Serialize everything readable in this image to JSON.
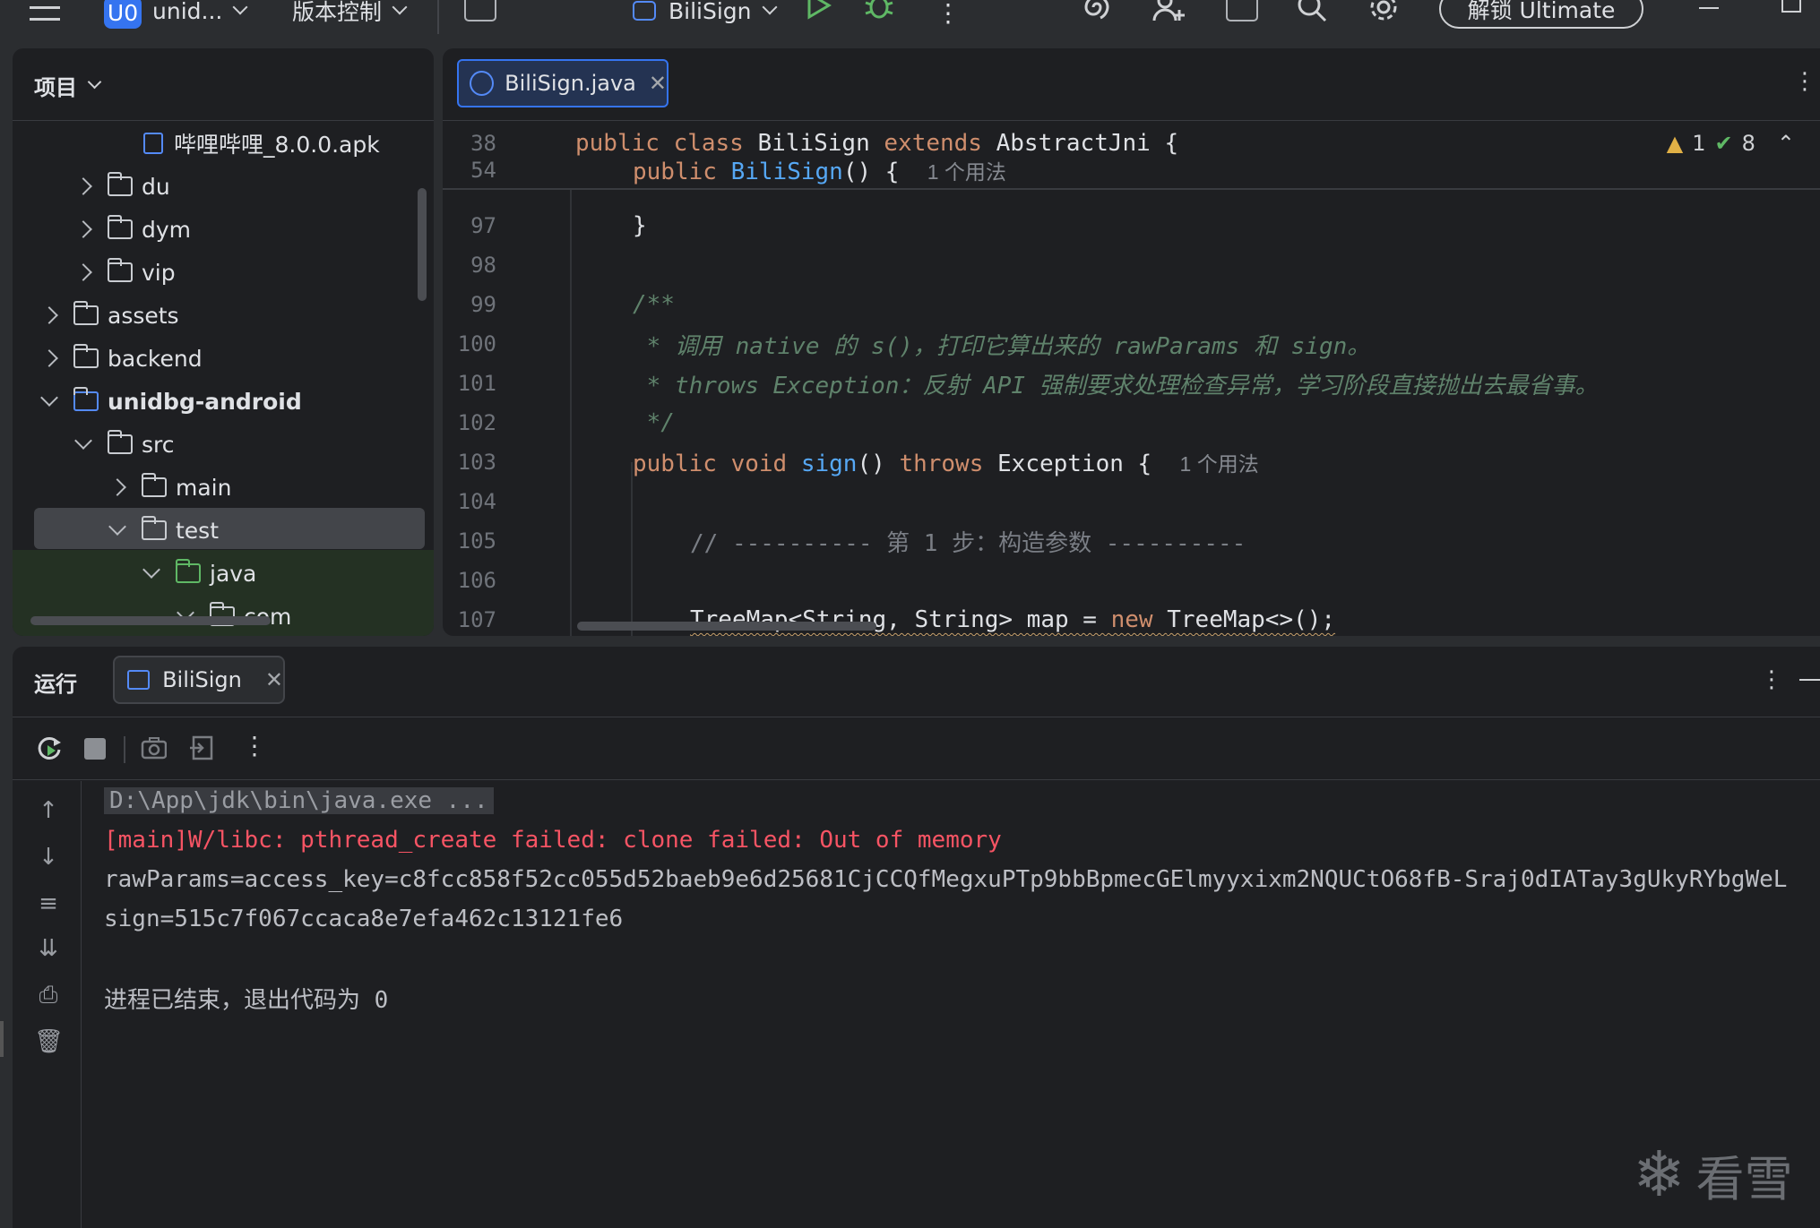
{
  "topbar": {
    "project_badge": "U0",
    "project_name": "unid...",
    "vcs_label": "版本控制",
    "run_config": "BiliSign",
    "more_glyph": "⋮",
    "ultimate_label": "解锁 Ultimate"
  },
  "project_panel": {
    "title": "项目",
    "items": [
      {
        "label": "哔哩哔哩_8.0.0.apk",
        "type": "apk"
      },
      {
        "label": "du",
        "type": "folder",
        "state": "collapsed"
      },
      {
        "label": "dym",
        "type": "folder",
        "state": "collapsed"
      },
      {
        "label": "vip",
        "type": "folder",
        "state": "collapsed"
      },
      {
        "label": "assets",
        "type": "folder",
        "state": "collapsed"
      },
      {
        "label": "backend",
        "type": "folder",
        "state": "collapsed"
      },
      {
        "label": "unidbg-android",
        "type": "module",
        "state": "expanded"
      },
      {
        "label": "src",
        "type": "folder",
        "state": "expanded"
      },
      {
        "label": "main",
        "type": "folder",
        "state": "collapsed"
      },
      {
        "label": "test",
        "type": "folder",
        "state": "expanded",
        "selected": true
      },
      {
        "label": "java",
        "type": "test-folder",
        "state": "expanded"
      },
      {
        "label": "com",
        "type": "package",
        "state": "expanded"
      }
    ]
  },
  "editor": {
    "tab_label": "BiliSign.java",
    "tab_close": "✕",
    "warnings_count": "1",
    "ok_count": "8",
    "lines": [
      {
        "num": "38",
        "text": "public class BiliSign extends AbstractJni {"
      },
      {
        "num": "54",
        "text": "public BiliSign() {",
        "hint": "1 个用法"
      },
      {
        "num": "97",
        "text": "}"
      },
      {
        "num": "98",
        "text": ""
      },
      {
        "num": "99",
        "text": "/**"
      },
      {
        "num": "100",
        "text": " * 调用 native 的 s()，打印它算出来的 rawParams 和 sign。"
      },
      {
        "num": "101",
        "text": " * throws Exception：反射 API 强制要求处理检查异常，学习阶段直接抛出去最省事。"
      },
      {
        "num": "102",
        "text": " */"
      },
      {
        "num": "103",
        "text": "public void sign() throws Exception {",
        "hint": "1 个用法"
      },
      {
        "num": "104",
        "text": ""
      },
      {
        "num": "105",
        "text": "// ---------- 第 1 步：构造参数 ----------"
      },
      {
        "num": "106",
        "text": ""
      },
      {
        "num": "107",
        "text": "TreeMap<String, String> map = new TreeMap<>();"
      }
    ]
  },
  "run_panel": {
    "title": "运行",
    "tab_label": "BiliSign",
    "tab_close": "✕",
    "console": {
      "cmd": "D:\\App\\jdk\\bin\\java.exe ...",
      "error": "[main]W/libc: pthread_create failed: clone failed: Out of memory",
      "raw_params": "rawParams=access_key=c8fcc858f52cc055d52baeb9e6d25681CjCCQfMegxuPTp9bbBpmecGElmyyxixm2NQUCtO68fB-Sraj0dIATay3gUkyRYbgWeL",
      "sign": "sign=515c7f067ccaca8e7efa462c13121fe6",
      "exit": "进程已结束，退出代码为 0"
    }
  },
  "watermark": "看雪",
  "colors": {
    "accent": "#3574f0",
    "error": "#f75464",
    "keyword": "#cf8e6d",
    "function": "#56a8f5",
    "doc_comment": "#5f826b"
  }
}
